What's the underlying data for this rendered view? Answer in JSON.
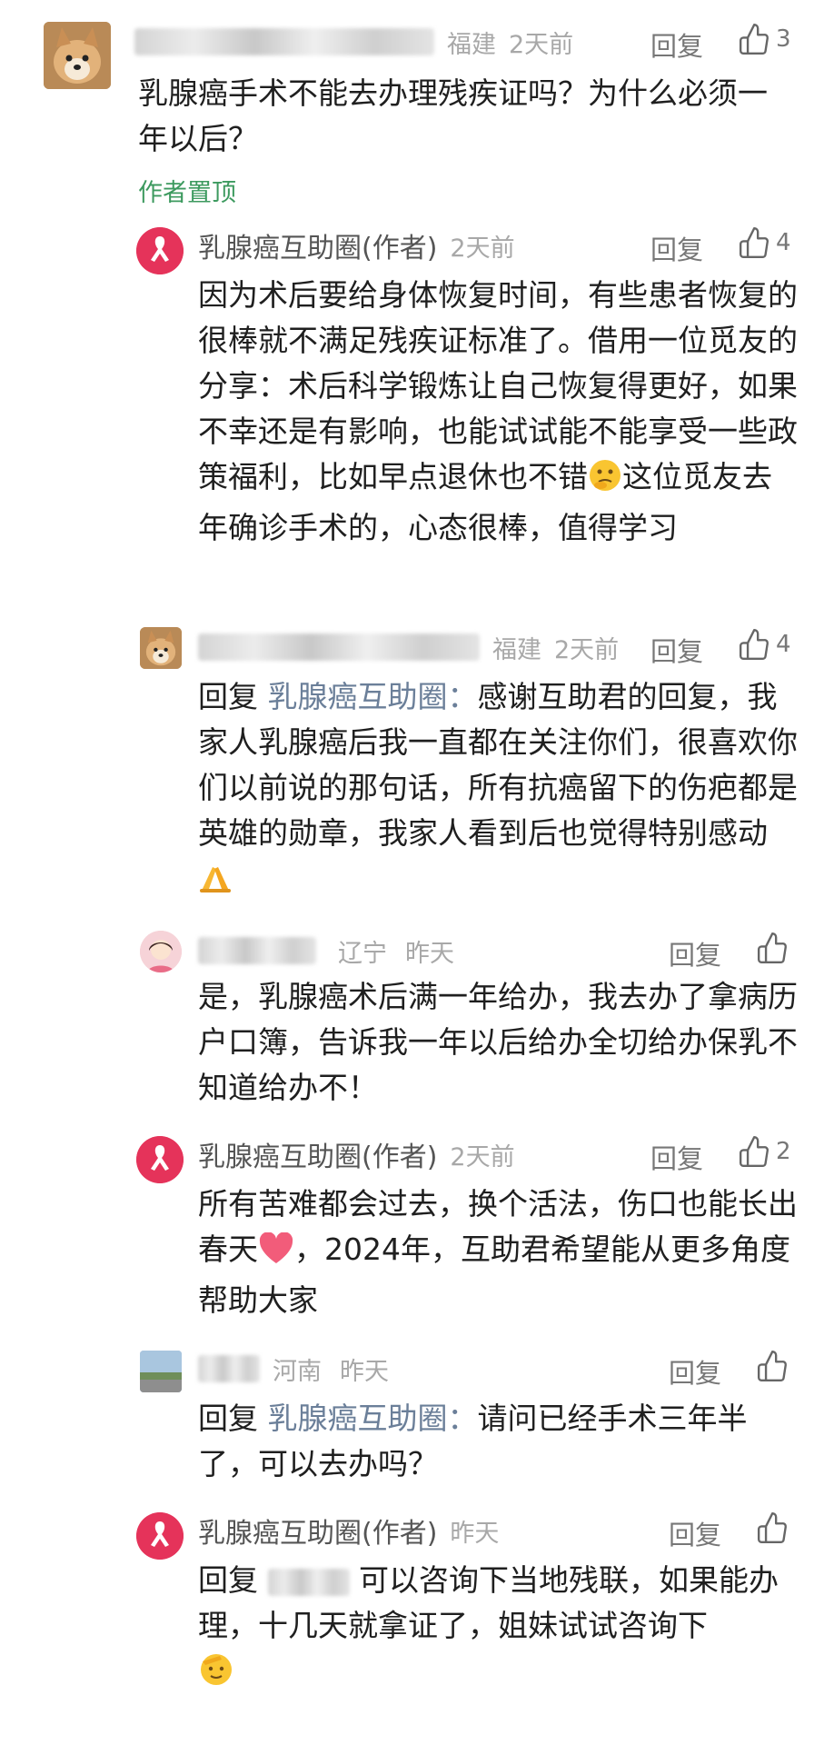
{
  "common": {
    "reply": "回复",
    "reply_prefix": "回复",
    "reply_to": "乳腺癌互助圈：",
    "author_name": "乳腺癌互助圈(作者)"
  },
  "comments": [
    {
      "location": "福建",
      "time": "2天前",
      "likes": "3",
      "text": "乳腺癌手术不能去办理残疾证吗？为什么必须一年以后？",
      "pinned": "作者置顶"
    },
    {
      "time": "2天前",
      "likes": "4",
      "text": "因为术后要给身体恢复时间，有些患者恢复的很棒就不满足残疾证标准了。借用一位觅友的分享：术后科学锻炼让自己恢复得更好，如果不幸还是有影响，也能试试能不能享受一些政策福利，比如早点退休也不错",
      "text2": "这位觅友去年确诊手术的，心态很棒，值得学习"
    },
    {
      "location": "福建",
      "time": "2天前",
      "likes": "4",
      "text": "感谢互助君的回复，我家人乳腺癌后我一直都在关注你们，很喜欢你们以前说的那句话，所有抗癌留下的伤疤都是英雄的勋章，我家人看到后也觉得特别感动"
    },
    {
      "location": "辽宁",
      "time": "昨天",
      "text": "是，乳腺癌术后满一年给办，我去办了拿病历户口簿，告诉我一年以后给办全切给办保乳不知道给办不！"
    },
    {
      "time": "2天前",
      "likes": "2",
      "text": "所有苦难都会过去，换个活法，伤口也能长出春天",
      "text2": "，2024年，互助君希望能从更多角度帮助大家"
    },
    {
      "location": "河南",
      "time": "昨天",
      "text": "请问已经手术三年半了，可以去办吗？"
    },
    {
      "time": "昨天",
      "text": "可以咨询下当地残联，如果能办理，十几天就拿证了，姐妹试试咨询下"
    }
  ]
}
